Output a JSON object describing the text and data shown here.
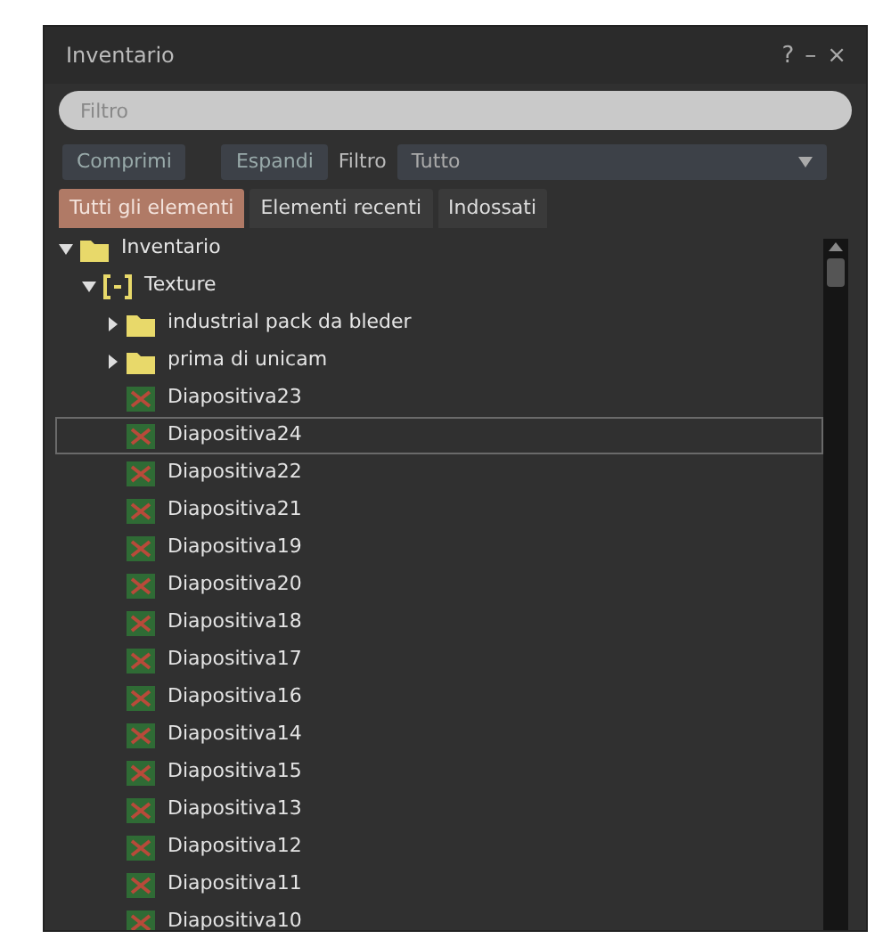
{
  "window": {
    "title": "Inventario",
    "buttons": [
      "?",
      "–",
      "×"
    ]
  },
  "filter_field": {
    "placeholder": "Filtro"
  },
  "toolbar": {
    "collapse_button": "Comprimi",
    "expand_button": "Espandi",
    "filter_label": "Filtro",
    "filter_dropdown": "Tutto"
  },
  "tabs": [
    {
      "label": "Tutti gli elementi",
      "selected": true
    },
    {
      "label": "Elementi recenti",
      "selected": false
    },
    {
      "label": "Indossati",
      "selected": false
    }
  ],
  "tree": [
    {
      "label": "Inventario",
      "kind": "folder",
      "expanded": true,
      "selected": false,
      "children": [
        {
          "label": "Texture",
          "kind": "category",
          "expanded": true,
          "selected": false,
          "children": [
            {
              "label": "industrial pack da bleder",
              "kind": "folder",
              "expanded": false,
              "selected": false
            },
            {
              "label": "prima di unicam",
              "kind": "folder",
              "expanded": false,
              "selected": false
            },
            {
              "label": "Diapositiva23",
              "kind": "texture",
              "selected": false
            },
            {
              "label": "Diapositiva24",
              "kind": "texture",
              "selected": true
            },
            {
              "label": "Diapositiva22",
              "kind": "texture",
              "selected": false
            },
            {
              "label": "Diapositiva21",
              "kind": "texture",
              "selected": false
            },
            {
              "label": "Diapositiva19",
              "kind": "texture",
              "selected": false
            },
            {
              "label": "Diapositiva20",
              "kind": "texture",
              "selected": false
            },
            {
              "label": "Diapositiva18",
              "kind": "texture",
              "selected": false
            },
            {
              "label": "Diapositiva17",
              "kind": "texture",
              "selected": false
            },
            {
              "label": "Diapositiva16",
              "kind": "texture",
              "selected": false
            },
            {
              "label": "Diapositiva14",
              "kind": "texture",
              "selected": false
            },
            {
              "label": "Diapositiva15",
              "kind": "texture",
              "selected": false
            },
            {
              "label": "Diapositiva13",
              "kind": "texture",
              "selected": false
            },
            {
              "label": "Diapositiva12",
              "kind": "texture",
              "selected": false
            },
            {
              "label": "Diapositiva11",
              "kind": "texture",
              "selected": false
            },
            {
              "label": "Diapositiva10",
              "kind": "texture",
              "selected": false
            }
          ]
        }
      ]
    }
  ]
}
